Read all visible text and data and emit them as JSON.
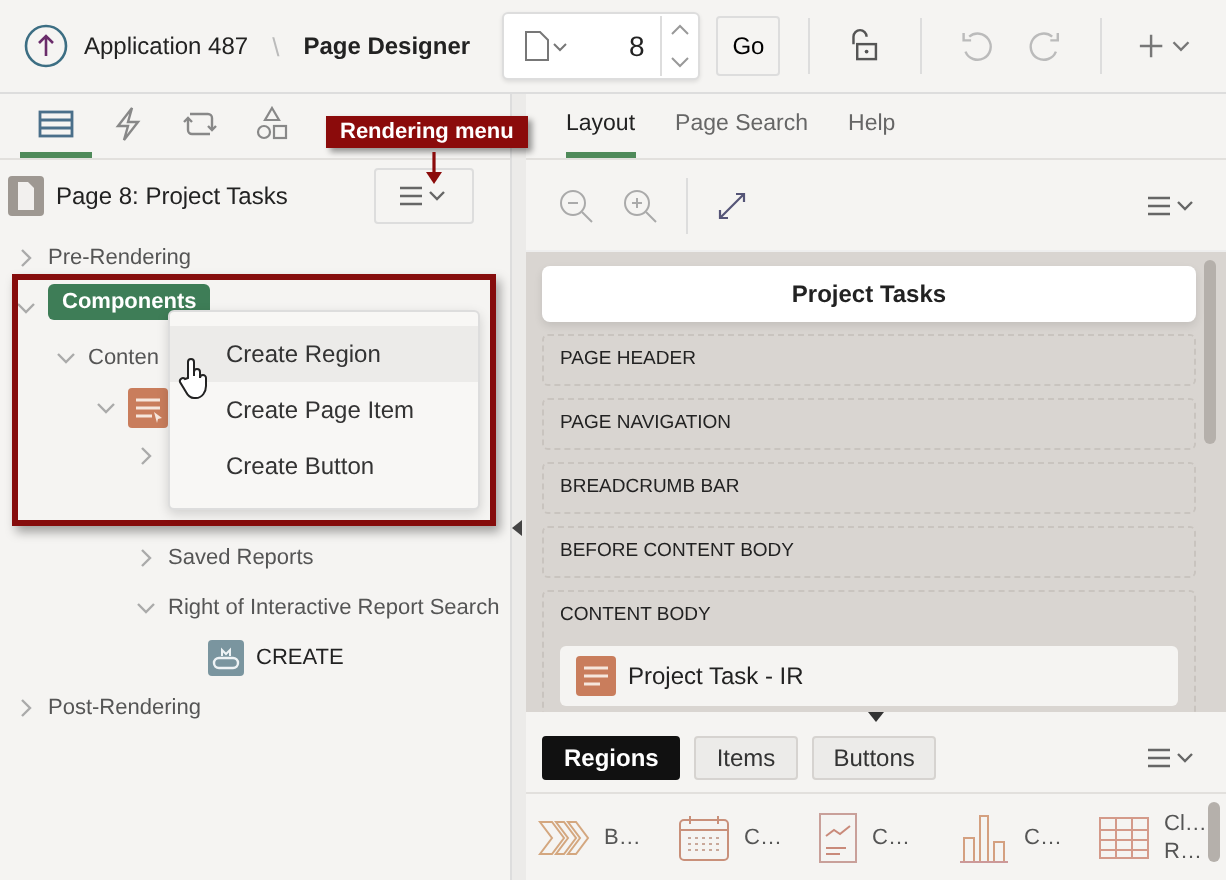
{
  "header": {
    "application": "Application 487",
    "separator": "\\",
    "page_designer": "Page Designer",
    "page_number": "8",
    "go": "Go"
  },
  "left_tabs": [
    {
      "kind": "rendering",
      "selected": true
    },
    {
      "kind": "dynamic-actions",
      "selected": false
    },
    {
      "kind": "processing",
      "selected": false
    },
    {
      "kind": "shared",
      "selected": false
    }
  ],
  "page_title": "Page 8: Project Tasks",
  "tree": [
    {
      "kind": "node",
      "label": "Pre-Rendering",
      "expanded": false,
      "selected": false
    },
    {
      "kind": "node",
      "label": "Components",
      "expanded": true,
      "selected": true,
      "children": [
        {
          "kind": "node",
          "label": "Conten",
          "expanded": true,
          "selected": false,
          "children": [
            {
              "kind": "region",
              "expanded": true,
              "selected": false,
              "children": [
                {
                  "kind": "node",
                  "expanded": false,
                  "selected": false
                },
                {
                  "kind": "node",
                  "label": "Saved Reports",
                  "expanded": false,
                  "selected": false
                },
                {
                  "kind": "node",
                  "label": "Right of Interactive Report Search",
                  "expanded": true,
                  "selected": false,
                  "children": [
                    {
                      "kind": "button",
                      "label": "CREATE",
                      "selected": false
                    }
                  ]
                }
              ]
            }
          ]
        }
      ]
    },
    {
      "kind": "node",
      "label": "Post-Rendering",
      "expanded": false,
      "selected": false
    }
  ],
  "context_menu": [
    {
      "label": "Create Region",
      "hovered": true
    },
    {
      "label": "Create Page Item",
      "hovered": false
    },
    {
      "label": "Create Button",
      "hovered": false
    }
  ],
  "callout": {
    "label": "Rendering menu"
  },
  "right_tabs": [
    {
      "label": "Layout",
      "selected": true
    },
    {
      "label": "Page Search",
      "selected": false
    },
    {
      "label": "Help",
      "selected": false
    }
  ],
  "layout": {
    "page_title": "Project Tasks",
    "sections": [
      {
        "label": "PAGE HEADER"
      },
      {
        "label": "PAGE NAVIGATION"
      },
      {
        "label": "BREADCRUMB BAR"
      },
      {
        "label": "BEFORE CONTENT BODY"
      },
      {
        "label": "CONTENT BODY",
        "regions": [
          {
            "label": "Project Task - IR"
          }
        ]
      }
    ]
  },
  "gallery_tabs": [
    {
      "label": "Regions",
      "selected": true
    },
    {
      "label": "Items",
      "selected": false
    },
    {
      "label": "Buttons",
      "selected": false
    }
  ],
  "gallery": [
    {
      "kind": "breadcrumb",
      "lines": [
        "B…"
      ]
    },
    {
      "kind": "calendar",
      "lines": [
        "C…"
      ]
    },
    {
      "kind": "card",
      "lines": [
        "C…"
      ]
    },
    {
      "kind": "chart",
      "lines": [
        "C…"
      ]
    },
    {
      "kind": "report",
      "lines": [
        "Cl…",
        "R…"
      ]
    }
  ]
}
